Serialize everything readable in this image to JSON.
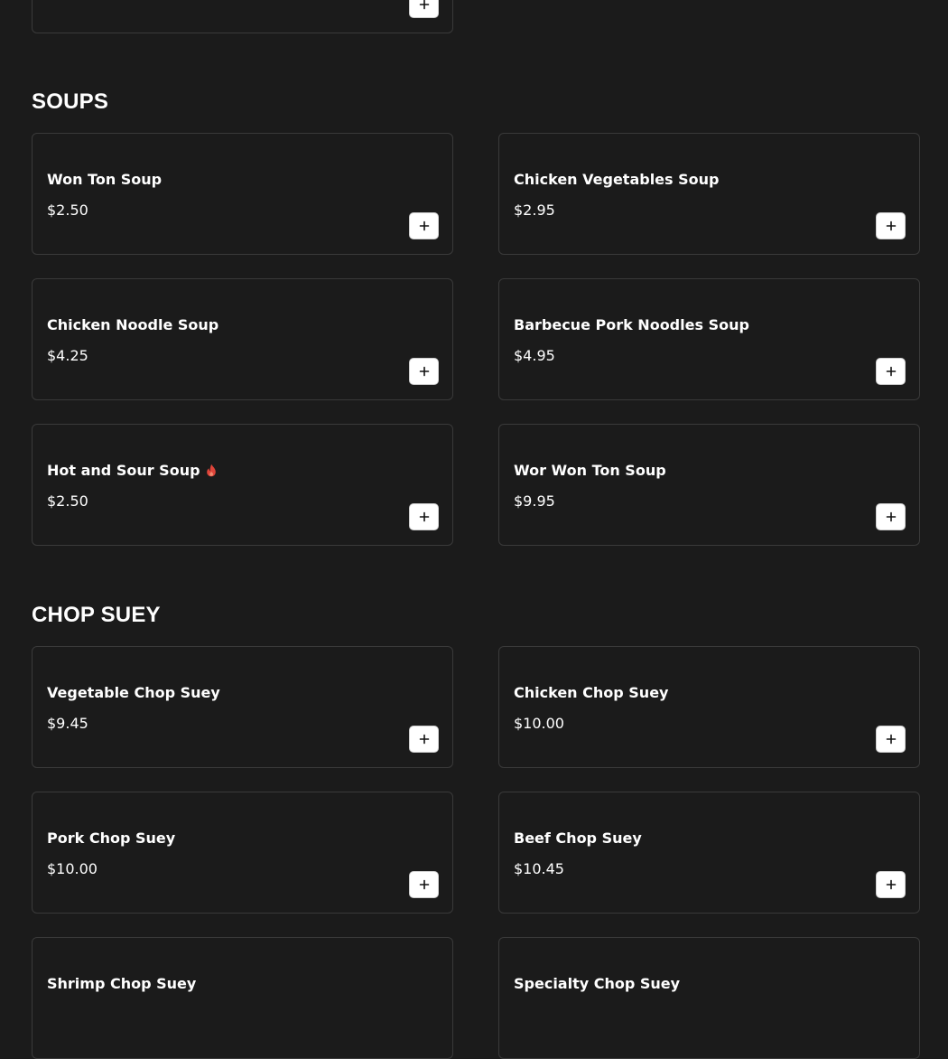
{
  "sections": {
    "soups": {
      "title": "SOUPS",
      "items": [
        {
          "name": "Won Ton Soup",
          "price": "$2.50",
          "spicy": false
        },
        {
          "name": "Chicken Vegetables Soup",
          "price": "$2.95",
          "spicy": false
        },
        {
          "name": "Chicken Noodle Soup",
          "price": "$4.25",
          "spicy": false
        },
        {
          "name": "Barbecue Pork Noodles Soup",
          "price": "$4.95",
          "spicy": false
        },
        {
          "name": "Hot and Sour Soup",
          "price": "$2.50",
          "spicy": true
        },
        {
          "name": "Wor Won Ton Soup",
          "price": "$9.95",
          "spicy": false
        }
      ]
    },
    "chop_suey": {
      "title": "CHOP SUEY",
      "items": [
        {
          "name": "Vegetable Chop Suey",
          "price": "$9.45",
          "spicy": false
        },
        {
          "name": "Chicken Chop Suey",
          "price": "$10.00",
          "spicy": false
        },
        {
          "name": "Pork Chop Suey",
          "price": "$10.00",
          "spicy": false
        },
        {
          "name": "Beef Chop Suey",
          "price": "$10.45",
          "spicy": false
        },
        {
          "name": "Shrimp Chop Suey",
          "price": "",
          "spicy": false
        },
        {
          "name": "Specialty Chop Suey",
          "price": "",
          "spicy": false
        }
      ]
    }
  },
  "icons": {
    "add": "plus-icon",
    "spicy": "flame-icon"
  },
  "colors": {
    "background": "#1b1b1b",
    "card_border": "#3a3a3a",
    "spicy": "#e0453a",
    "button_bg": "#ffffff"
  }
}
